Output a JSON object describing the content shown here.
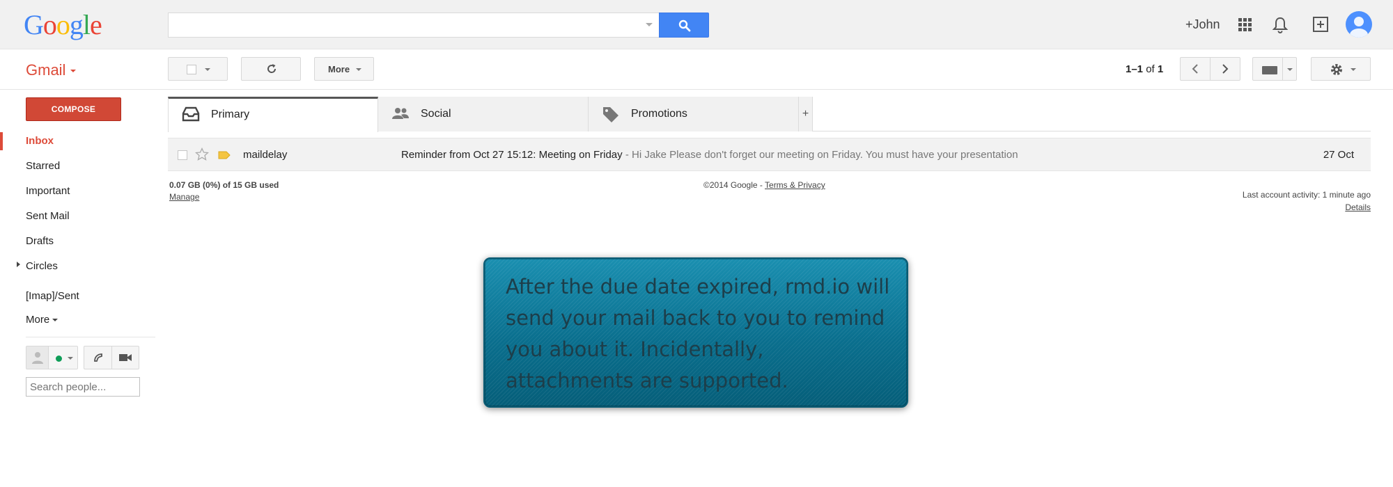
{
  "header": {
    "logo_letters": [
      {
        "ch": "G",
        "color": "#4285f4"
      },
      {
        "ch": "o",
        "color": "#ea4335"
      },
      {
        "ch": "o",
        "color": "#fbbc05"
      },
      {
        "ch": "g",
        "color": "#4285f4"
      },
      {
        "ch": "l",
        "color": "#34a853"
      },
      {
        "ch": "e",
        "color": "#ea4335"
      }
    ],
    "search": {
      "value": "",
      "placeholder": ""
    },
    "user_link": "+John",
    "icons": [
      "search-icon",
      "apps-icon",
      "bell-icon",
      "share-icon",
      "avatar"
    ]
  },
  "toolbar": {
    "app_label": "Gmail",
    "more_label": "More",
    "pager": {
      "range": "1–1",
      "of": "of",
      "total": "1"
    }
  },
  "sidebar": {
    "compose_label": "COMPOSE",
    "items": [
      {
        "label": "Inbox",
        "active": true
      },
      {
        "label": "Starred"
      },
      {
        "label": "Important"
      },
      {
        "label": "Sent Mail"
      },
      {
        "label": "Drafts"
      },
      {
        "label": "Circles"
      },
      {
        "label": "[Imap]/Sent"
      },
      {
        "label": "More"
      }
    ],
    "search_people_placeholder": "Search people..."
  },
  "tabs": [
    {
      "label": "Primary",
      "selected": true,
      "icon": "inbox-icon"
    },
    {
      "label": "Social",
      "icon": "people-icon"
    },
    {
      "label": "Promotions",
      "icon": "tag-icon"
    }
  ],
  "tab_add_label": "+",
  "messages": [
    {
      "sender": "maildelay",
      "subject": "Reminder from Oct 27 15:12: Meeting on Friday",
      "snippet": " - Hi Jake Please don't forget our meeting on Friday. You must have your presentation",
      "date": "27 Oct"
    }
  ],
  "footer": {
    "storage": "0.07 GB (0%) of 15 GB used",
    "manage": "Manage",
    "copyright": "©2014 Google - ",
    "terms": "Terms & Privacy",
    "activity": "Last account activity: 1 minute ago",
    "details": "Details"
  },
  "callout": {
    "text": "After the due date expired, rmd.io will send your mail back to you to remind you about it. Incidentally, attachments are supported."
  },
  "colors": {
    "brand_red": "#dd4b39",
    "compose_red": "#d14836",
    "search_blue": "#4285f4",
    "callout_blue": "#0c7a9b"
  }
}
